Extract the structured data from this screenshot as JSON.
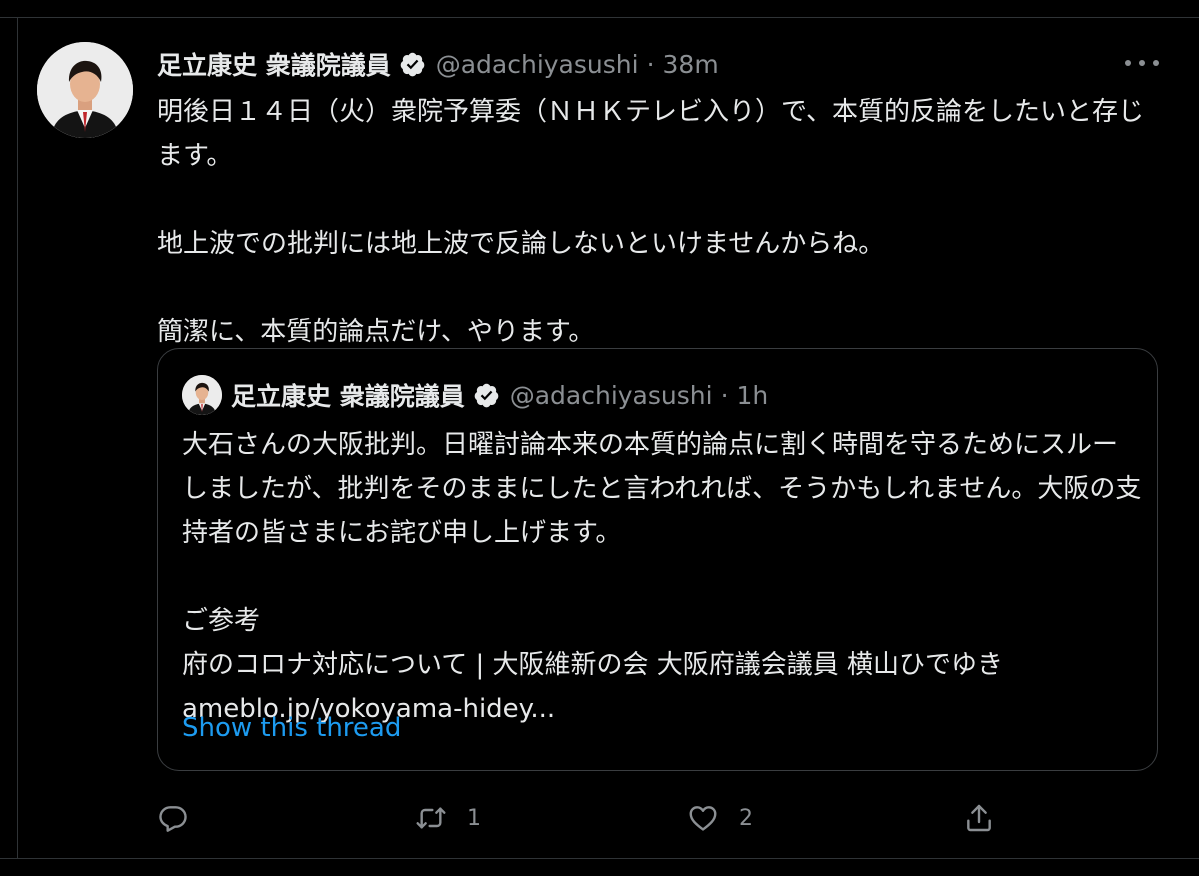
{
  "tweet": {
    "author_name": "足立康史 衆議院議員",
    "handle": "@adachiyasushi",
    "separator": "·",
    "time": "38m",
    "text": "明後日１４日（火）衆院予算委（ＮＨＫテレビ入り）で、本質的反論をしたいと存じます。\n\n地上波での批判には地上波で反論しないといけませんからね。\n\n簡潔に、本質的論点だけ、やります。"
  },
  "quoted_tweet": {
    "author_name": "足立康史 衆議院議員",
    "handle": "@adachiyasushi",
    "separator": "·",
    "time": "1h",
    "text": "大石さんの大阪批判。日曜討論本来の本質的論点に割く時間を守るためにスルーしましたが、批判をそのままにしたと言われれば、そうかもしれません。大阪の支持者の皆さまにお詫び申し上げます。\n\nご参考\n府のコロナ対応について | 大阪維新の会 大阪府議会議員 横山ひでゆき",
    "link": "ameblo.jp/yokoyama-hidey...",
    "show_thread": "Show this thread"
  },
  "actions": {
    "reply_count": "",
    "retweet_count": "1",
    "like_count": "2"
  },
  "icons": {
    "verified": "verified-badge-icon",
    "more": "more-dots-icon",
    "reply": "reply-icon",
    "retweet": "retweet-icon",
    "like": "heart-icon",
    "share": "share-icon"
  },
  "colors": {
    "background": "#000000",
    "text": "#e7e9ea",
    "secondary": "#8b8f93",
    "link": "#1d9bf0",
    "border": "#2f3336"
  }
}
